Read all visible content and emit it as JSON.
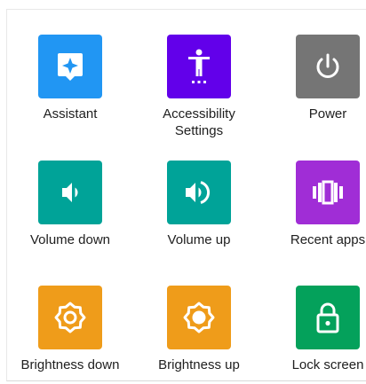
{
  "colors": {
    "blue": "#2196F3",
    "purple": "#6200EA",
    "gray": "#757575",
    "teal": "#00A398",
    "violet": "#A02DD6",
    "orange": "#EF9C1A",
    "green": "#04A15B"
  },
  "tiles": [
    {
      "label": "Assistant",
      "icon": "assistant-icon"
    },
    {
      "label": "Accessibility\nSettings",
      "icon": "accessibility-icon"
    },
    {
      "label": "Power",
      "icon": "power-icon"
    },
    {
      "label": "Volume down",
      "icon": "volume-down-icon"
    },
    {
      "label": "Volume up",
      "icon": "volume-up-icon"
    },
    {
      "label": "Recent apps",
      "icon": "recent-apps-icon"
    },
    {
      "label": "Brightness down",
      "icon": "brightness-down-icon"
    },
    {
      "label": "Brightness up",
      "icon": "brightness-up-icon"
    },
    {
      "label": "Lock screen",
      "icon": "lock-icon"
    }
  ]
}
